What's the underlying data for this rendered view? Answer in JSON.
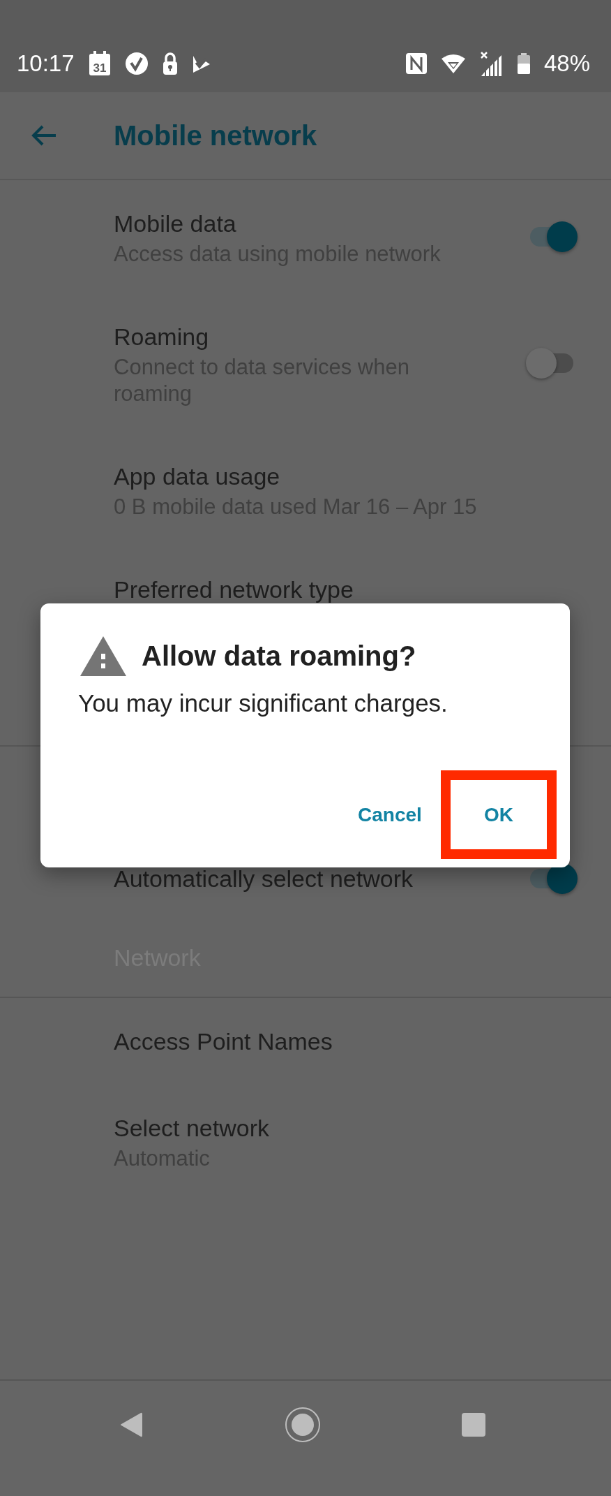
{
  "status_bar": {
    "time": "10:17",
    "calendar_day": "31",
    "battery": "48%"
  },
  "app_bar": {
    "title": "Mobile network"
  },
  "sections": [
    {
      "items": [
        {
          "kind": "switch",
          "title": "Mobile data",
          "summary": "Access data using mobile network",
          "on": true
        },
        {
          "kind": "switch",
          "title": "Roaming",
          "summary": "Connect to data services when roaming",
          "on": false
        },
        {
          "kind": "plain",
          "title": "App data usage",
          "summary": "0 B mobile data used Mar 16 – Apr 15"
        },
        {
          "kind": "plain",
          "title": "Preferred network type"
        }
      ]
    },
    {
      "items": [
        {
          "kind": "switch",
          "title": "Automatically select network",
          "on": true
        },
        {
          "kind": "header",
          "title": "Network"
        }
      ]
    },
    {
      "items": [
        {
          "kind": "plain",
          "title": "Access Point Names"
        },
        {
          "kind": "plain",
          "title": "Select network",
          "summary": "Automatic"
        }
      ]
    }
  ],
  "dialog": {
    "title": "Allow data roaming?",
    "message": "You may incur significant charges.",
    "buttons": [
      {
        "label": "Cancel",
        "highlighted": false
      },
      {
        "label": "OK",
        "highlighted": true
      }
    ]
  }
}
